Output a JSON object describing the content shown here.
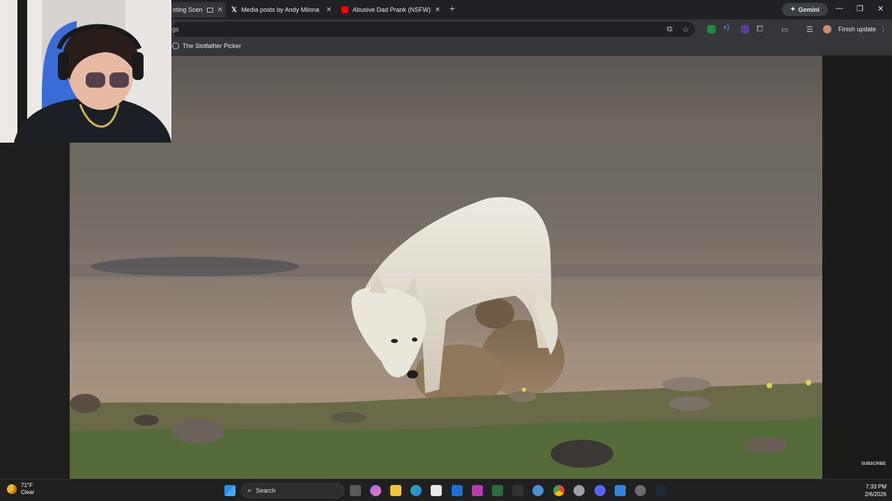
{
  "browser": {
    "tabs": [
      {
        "label": "nting Scen",
        "active": true
      },
      {
        "label": "Media posts by Andy Milonakis",
        "active": false
      },
      {
        "label": "Abusive Dad Prank (NSFW) - Yo",
        "active": false
      }
    ],
    "gemini_label": "Gemini",
    "address_text": "gs",
    "finish_update_label": "Finish update",
    "bookmark_label": "The Slotfather Picker"
  },
  "video": {
    "subscribe_label": "SUBSCRIBE"
  },
  "taskbar": {
    "weather_temp": "71°F",
    "weather_desc": "Clear",
    "search_label": "Search",
    "time": "7:33 PM",
    "date": "2/6/2026"
  },
  "colors": {
    "chrome_dark": "#202124",
    "chrome_toolbar": "#35363a",
    "youtube_red": "#ff0000",
    "windows_blue": "#2b8fe6"
  },
  "icons": [
    "x-logo-icon",
    "youtube-icon",
    "close-icon",
    "plus-icon",
    "gemini-spark-icon",
    "minimize-icon",
    "maximize-icon",
    "window-close-icon",
    "cast-icon",
    "bookmark-star-icon",
    "extensions-icon",
    "reading-list-icon",
    "profile-avatar-icon",
    "kebab-menu-icon",
    "globe-icon",
    "windows-start-icon",
    "search-icon",
    "chrome-icon",
    "edge-icon",
    "file-explorer-icon",
    "steam-icon",
    "discord-icon",
    "moon-weather-icon"
  ]
}
